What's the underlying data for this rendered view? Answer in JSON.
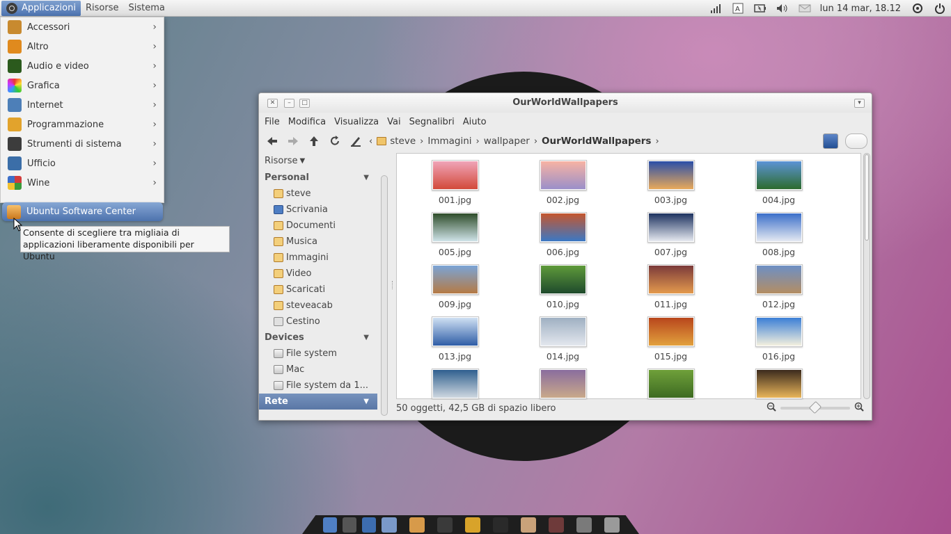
{
  "panel": {
    "menus": [
      "Applicazioni",
      "Risorse",
      "Sistema"
    ],
    "clock": "lun 14 mar, 18.12"
  },
  "app_menu": {
    "items": [
      {
        "label": "Accessori",
        "color": "#c88a2f"
      },
      {
        "label": "Altro",
        "color": "#e08a1e"
      },
      {
        "label": "Audio e video",
        "color": "#2b5a1d"
      },
      {
        "label": "Grafica",
        "color": "#d3414d"
      },
      {
        "label": "Internet",
        "color": "#4d7fb8"
      },
      {
        "label": "Programmazione",
        "color": "#e2a32c"
      },
      {
        "label": "Strumenti di sistema",
        "color": "#3c3c3c"
      },
      {
        "label": "Ufficio",
        "color": "#3b6ea8"
      },
      {
        "label": "Wine",
        "color": "#d23c3c"
      }
    ],
    "highlighted": "Ubuntu Software Center",
    "tooltip_line1": "Consente di scegliere tra migliaia di",
    "tooltip_line2": "applicazioni liberamente disponibili per Ubuntu"
  },
  "window": {
    "title": "OurWorldWallpapers",
    "menubar": [
      "File",
      "Modifica",
      "Visualizza",
      "Vai",
      "Segnalibri",
      "Aiuto"
    ],
    "breadcrumbs": [
      "steve",
      "Immagini",
      "wallpaper",
      "OurWorldWallpapers"
    ],
    "sidebar": {
      "header": "Risorse",
      "personal_title": "Personal",
      "personal": [
        "steve",
        "Scrivania",
        "Documenti",
        "Musica",
        "Immagini",
        "Video",
        "Scaricati",
        "steveacab",
        "Cestino"
      ],
      "devices_title": "Devices",
      "devices": [
        "File system",
        "Mac",
        "File system da 1..."
      ],
      "network_title": "Rete"
    },
    "files": [
      {
        "name": "001.jpg",
        "colors": [
          "#f0a4b8",
          "#d24a3a"
        ]
      },
      {
        "name": "002.jpg",
        "colors": [
          "#f7b3a3",
          "#9a8fc9"
        ]
      },
      {
        "name": "003.jpg",
        "colors": [
          "#2a4fa8",
          "#e8a95a"
        ]
      },
      {
        "name": "004.jpg",
        "colors": [
          "#5c94d6",
          "#2d6b2d"
        ]
      },
      {
        "name": "005.jpg",
        "colors": [
          "#2f4d2a",
          "#cfe3e8"
        ]
      },
      {
        "name": "006.jpg",
        "colors": [
          "#c4562e",
          "#3b78c4"
        ]
      },
      {
        "name": "007.jpg",
        "colors": [
          "#1d3260",
          "#e6e9f0"
        ]
      },
      {
        "name": "008.jpg",
        "colors": [
          "#3c6fc9",
          "#e4e9f2"
        ]
      },
      {
        "name": "009.jpg",
        "colors": [
          "#7aa4d6",
          "#b57a44"
        ]
      },
      {
        "name": "010.jpg",
        "colors": [
          "#5f9a3a",
          "#1e4a2c"
        ]
      },
      {
        "name": "011.jpg",
        "colors": [
          "#7b3a3a",
          "#e49a4d"
        ]
      },
      {
        "name": "012.jpg",
        "colors": [
          "#6d8fc4",
          "#b48e63"
        ]
      },
      {
        "name": "013.jpg",
        "colors": [
          "#cfe0f3",
          "#2f5da6"
        ]
      },
      {
        "name": "014.jpg",
        "colors": [
          "#9fb0c2",
          "#e3e7ee"
        ]
      },
      {
        "name": "015.jpg",
        "colors": [
          "#b8461c",
          "#e2a13d"
        ]
      },
      {
        "name": "016.jpg",
        "colors": [
          "#3b7fd6",
          "#f3f0de"
        ]
      },
      {
        "name": "",
        "colors": [
          "#2f5f8f",
          "#cfd8e0"
        ]
      },
      {
        "name": "",
        "colors": [
          "#8a6d9e",
          "#c9a98a"
        ]
      },
      {
        "name": "",
        "colors": [
          "#6fa03a",
          "#3e6b22"
        ]
      },
      {
        "name": "",
        "colors": [
          "#3b2a1d",
          "#e8b55a"
        ]
      }
    ],
    "status": "50 oggetti, 42,5 GB di spazio libero",
    "zoom_level": 0.5
  },
  "dock": {
    "icons": [
      "#4f7fc4",
      "#555555",
      "#3d6db0",
      "#7a99c9",
      "#d79a4a",
      "#3a3a3a",
      "#d8a32a",
      "#2a2a2a",
      "#c9a27a",
      "#6e3a3a",
      "#7a7a7a",
      "#9a9a9a"
    ]
  }
}
